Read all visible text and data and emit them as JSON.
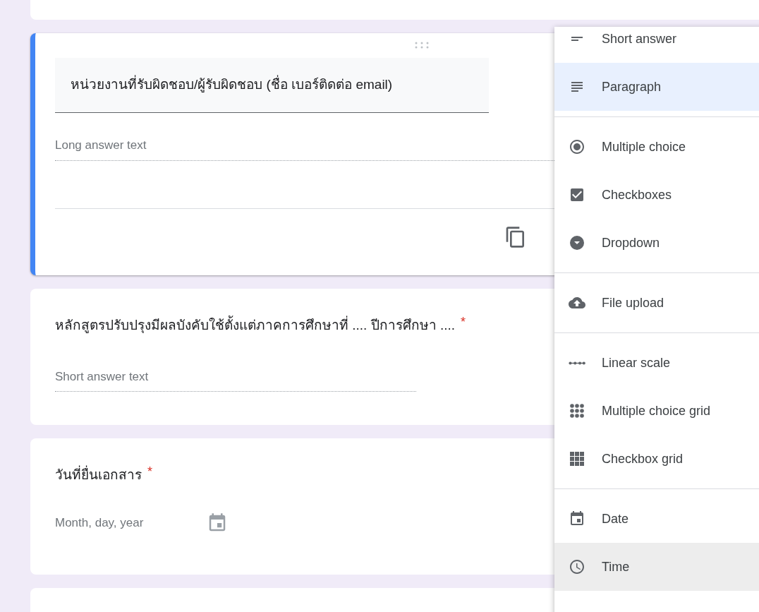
{
  "asterisk": "*",
  "questions": [
    {
      "kind": "paragraph",
      "title": "หน่วยงานที่รับผิดชอบ/ผู้รับผิดชอบ (ชื่อ เบอร์ติดต่อ email)",
      "active": true,
      "placeholder": "Long answer text"
    },
    {
      "kind": "short",
      "title": "หลักสูตรปรับปรุงมีผลบังคับใช้ตั้งแต่ภาคการศึกษาที่ .... ปีการศึกษา ....",
      "required": true,
      "active": false,
      "placeholder": "Short answer text"
    },
    {
      "kind": "date",
      "title": "วันที่ยื่นเอกสาร",
      "required": true,
      "active": false,
      "placeholder": "Month, day, year"
    }
  ],
  "type_menu": {
    "sections": [
      [
        {
          "kind": "short",
          "label": "Short answer",
          "selected": false,
          "hovered": false
        },
        {
          "kind": "paragraph",
          "label": "Paragraph",
          "selected": true,
          "hovered": false
        }
      ],
      [
        {
          "kind": "radio",
          "label": "Multiple choice",
          "selected": false,
          "hovered": false
        },
        {
          "kind": "checkbox",
          "label": "Checkboxes",
          "selected": false,
          "hovered": false
        },
        {
          "kind": "dropdown",
          "label": "Dropdown",
          "selected": false,
          "hovered": false
        }
      ],
      [
        {
          "kind": "upload",
          "label": "File upload",
          "selected": false,
          "hovered": false
        }
      ],
      [
        {
          "kind": "scale",
          "label": "Linear scale",
          "selected": false,
          "hovered": false
        },
        {
          "kind": "radio_grid",
          "label": "Multiple choice grid",
          "selected": false,
          "hovered": false
        },
        {
          "kind": "checkbox_grid",
          "label": "Checkbox grid",
          "selected": false,
          "hovered": false
        }
      ],
      [
        {
          "kind": "date",
          "label": "Date",
          "selected": false,
          "hovered": false
        },
        {
          "kind": "time",
          "label": "Time",
          "selected": false,
          "hovered": true
        }
      ]
    ]
  }
}
